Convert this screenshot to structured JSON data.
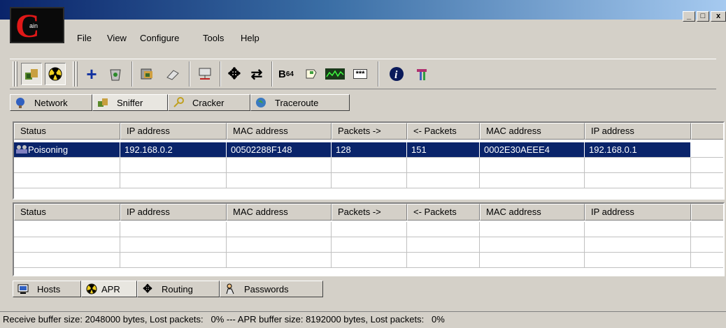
{
  "window": {
    "logo_text": "ain",
    "controls": {
      "minimize": "_",
      "maximize": "□",
      "close": "x"
    }
  },
  "menu": [
    "File",
    "View",
    "Configure",
    "Tools",
    "Help"
  ],
  "toolbar": {
    "icons": [
      "start-sniffer-icon",
      "apr-poison-icon",
      "add-to-list-icon",
      "remove-icon",
      "database-icon",
      "cable-icon",
      "network-icon",
      "ip-routing-icon",
      "move-icon",
      "swap-icon",
      "base64-icon",
      "note-icon",
      "graph-icon",
      "password-box-icon",
      "info-icon",
      "hammer-icon"
    ],
    "base64_label": "B",
    "base64_sub": "64",
    "password_label": "***"
  },
  "top_tabs": [
    {
      "label": "Network",
      "icon": "network-icon"
    },
    {
      "label": "Sniffer",
      "icon": "sniffer-icon",
      "active": true
    },
    {
      "label": "Cracker",
      "icon": "key-icon"
    },
    {
      "label": "Traceroute",
      "icon": "globe-icon"
    }
  ],
  "upper_table": {
    "columns": [
      "Status",
      "IP address",
      "MAC address",
      "Packets ->",
      "<- Packets",
      "MAC address",
      "IP address"
    ],
    "rows": [
      [
        "Poisoning",
        "192.168.0.2",
        "00502288F148",
        "128",
        "151",
        "0002E30AEEE4",
        "192.168.0.1"
      ]
    ]
  },
  "lower_table": {
    "columns": [
      "Status",
      "IP address",
      "MAC address",
      "Packets ->",
      "<- Packets",
      "MAC address",
      "IP address"
    ],
    "rows": []
  },
  "bottom_tabs": [
    {
      "label": "Hosts",
      "icon": "monitor-icon"
    },
    {
      "label": "APR",
      "icon": "radiation-icon",
      "active": true
    },
    {
      "label": "Routing",
      "icon": "arrows-icon"
    },
    {
      "label": "Passwords",
      "icon": "person-icon"
    }
  ],
  "status": "Receive buffer size: 2048000 bytes, Lost packets:   0% --- APR buffer size: 8192000 bytes, Lost packets:   0%"
}
